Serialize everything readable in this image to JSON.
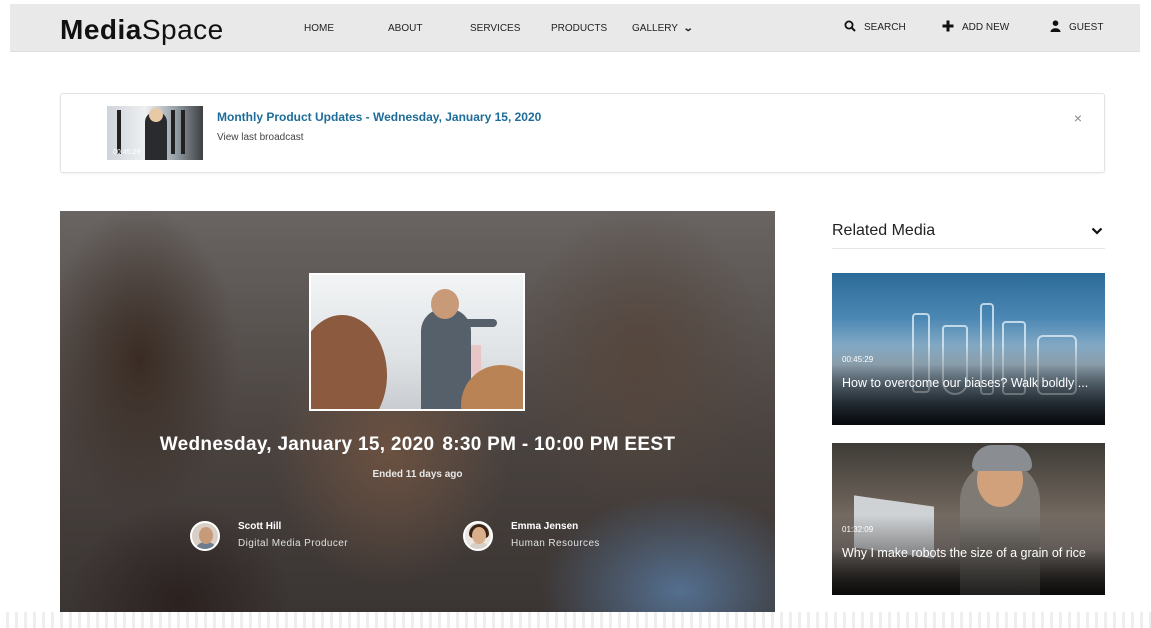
{
  "header": {
    "logo_bold": "Media",
    "logo_light": "Space",
    "nav": [
      "HOME",
      "ABOUT",
      "SERVICES",
      "PRODUCTS",
      "GALLERY"
    ],
    "search_label": "SEARCH",
    "add_new_label": "ADD NEW",
    "guest_label": "GUEST"
  },
  "notification": {
    "thumb_duration": "00:45:29",
    "title": "Monthly Product Updates - Wednesday,  January 15, 2020",
    "subtitle": "View last broadcast",
    "close": "×"
  },
  "event": {
    "date": "Wednesday, January 15, 2020",
    "time": "8:30 PM - 10:00 PM EEST",
    "status": "Ended 11 days ago",
    "presenters": [
      {
        "name": "Scott Hill",
        "role": "Digital Media Producer"
      },
      {
        "name": "Emma Jensen",
        "role": "Human Resources"
      }
    ]
  },
  "related": {
    "title": "Related Media",
    "items": [
      {
        "duration": "00:45:29",
        "caption": "How to overcome our biases? Walk boldly ..."
      },
      {
        "duration": "01:32:09",
        "caption": "Why I make robots the size of a grain of rice"
      }
    ]
  }
}
